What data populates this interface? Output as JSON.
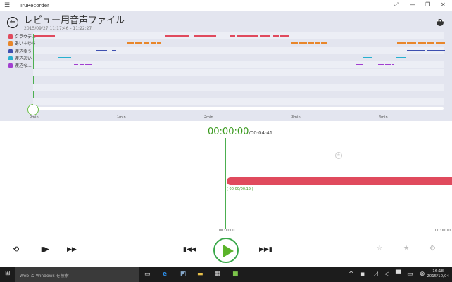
{
  "app": {
    "title": "TruRecorder"
  },
  "header": {
    "title": "レビュー用音声ファイル",
    "date": "2015/09/27 11:17:46 - 11:22:27"
  },
  "speakers": [
    {
      "name": "クラウデ...",
      "color": "#e04a5d",
      "segments": [
        [
          0,
          15
        ],
        [
          91,
          107
        ],
        [
          111,
          126
        ],
        [
          135,
          139
        ],
        [
          140,
          155
        ],
        [
          156,
          163
        ],
        [
          165,
          169
        ],
        [
          170,
          176
        ]
      ]
    },
    {
      "name": "あい＋ゆう",
      "color": "#e8862a",
      "segments": [
        [
          65,
          69
        ],
        [
          70,
          75
        ],
        [
          76,
          80
        ],
        [
          81,
          84
        ],
        [
          85,
          88
        ],
        [
          177,
          182
        ],
        [
          183,
          188
        ],
        [
          189,
          193
        ],
        [
          194,
          197
        ],
        [
          198,
          202
        ],
        [
          250,
          256
        ],
        [
          257,
          263
        ],
        [
          264,
          270
        ],
        [
          271,
          276
        ],
        [
          277,
          283
        ]
      ]
    },
    {
      "name": "渡辺ゆう",
      "color": "#3d4fb0",
      "segments": [
        [
          43,
          51
        ],
        [
          54,
          57
        ],
        [
          257,
          269
        ],
        [
          271,
          283
        ]
      ]
    },
    {
      "name": "渡辺あい",
      "color": "#27b0cf",
      "segments": [
        [
          17,
          26
        ],
        [
          227,
          233
        ],
        [
          249,
          256
        ]
      ]
    },
    {
      "name": "渡辺な...",
      "color": "#a23fd0",
      "segments": [
        [
          28,
          31
        ],
        [
          32,
          35
        ],
        [
          36,
          40
        ],
        [
          222,
          227
        ],
        [
          237,
          241
        ],
        [
          242,
          246
        ],
        [
          247,
          248
        ]
      ]
    }
  ],
  "timeline": {
    "total_seconds": 281,
    "ticks": [
      "0min",
      "1min",
      "2min",
      "3min",
      "4min"
    ]
  },
  "player": {
    "current": "00:00:00",
    "total": "/00:04:41",
    "segment_time": "( 00:00/00:15 )",
    "axis_start": "00:00:00",
    "axis_end": "00:00:10"
  },
  "taskbar": {
    "search": "Web と Windows を検索",
    "time": "16:18",
    "date": "2015/10/04"
  }
}
